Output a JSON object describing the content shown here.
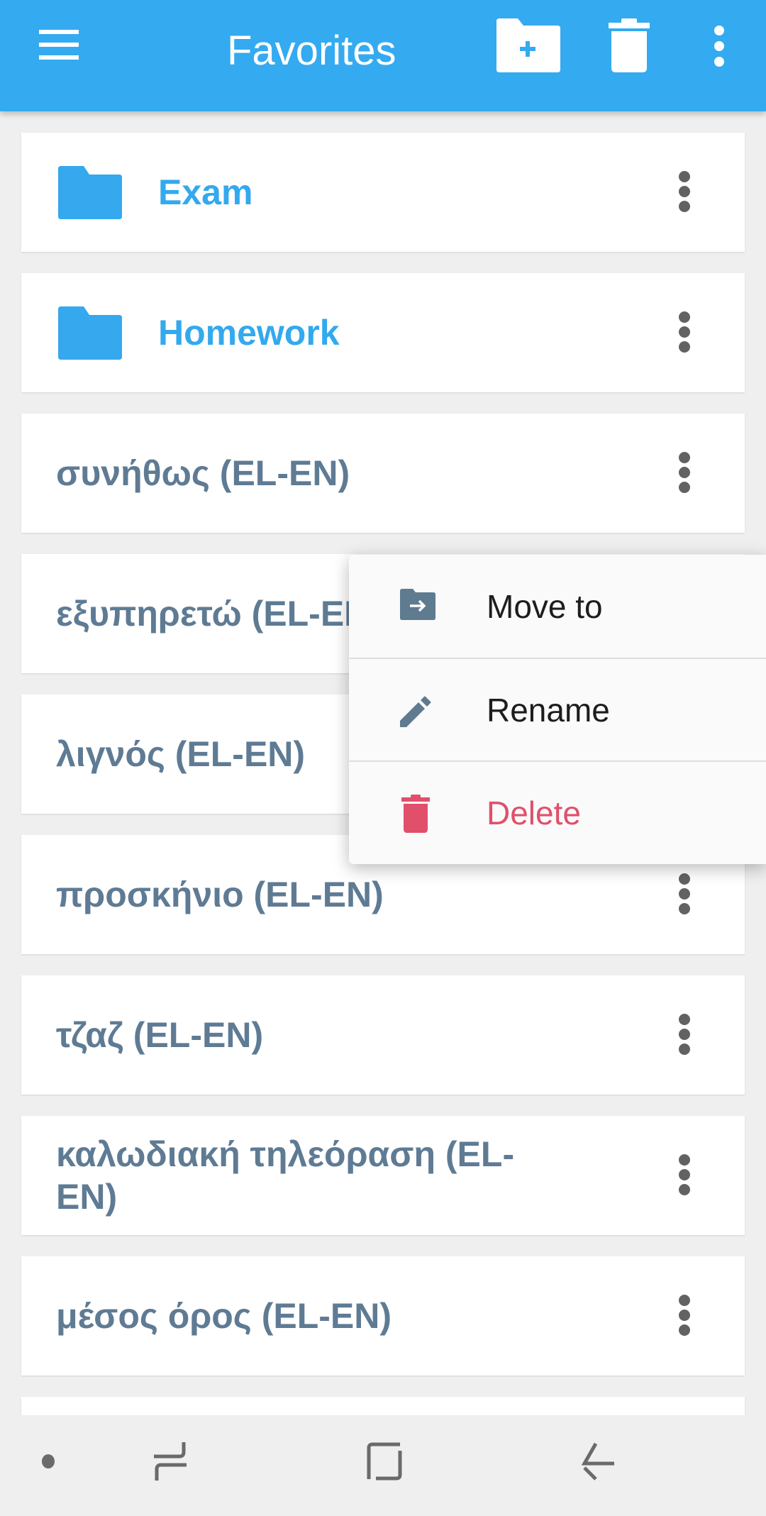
{
  "appbar": {
    "title": "Favorites",
    "menu_icon": "hamburger-menu-icon",
    "actions": [
      {
        "name": "new-folder",
        "icon": "folder-plus-icon"
      },
      {
        "name": "delete-all",
        "icon": "trash-icon"
      },
      {
        "name": "overflow",
        "icon": "more-vert-icon"
      }
    ],
    "background_color": "#34aaf0"
  },
  "list": {
    "folders": [
      {
        "label": "Exam",
        "icon": "folder-icon"
      },
      {
        "label": "Homework",
        "icon": "folder-icon"
      }
    ],
    "words": [
      {
        "label": "συνήθως (EL-EN)"
      },
      {
        "label": "εξυπηρετώ (EL-EN)"
      },
      {
        "label": "λιγνός (EL-EN)"
      },
      {
        "label": "προσκήνιο (EL-EN)"
      },
      {
        "label": "τζαζ (EL-EN)"
      },
      {
        "label": "καλωδιακή τηλεόραση (EL-EN)"
      },
      {
        "label": "μέσος όρος (EL-EN)"
      }
    ],
    "folder_text_color": "#33a9ee",
    "word_text_color": "#5f7b94"
  },
  "context_menu": {
    "items": [
      {
        "label": "Move to",
        "icon": "folder-move-icon"
      },
      {
        "label": "Rename",
        "icon": "pencil-icon"
      },
      {
        "label": "Delete",
        "icon": "trash-icon",
        "color": "#e0506b"
      }
    ]
  },
  "navbar": {
    "buttons": [
      {
        "name": "dot",
        "icon": "dot-icon"
      },
      {
        "name": "recents",
        "icon": "recents-icon"
      },
      {
        "name": "home",
        "icon": "home-icon"
      },
      {
        "name": "back",
        "icon": "back-icon"
      }
    ]
  }
}
